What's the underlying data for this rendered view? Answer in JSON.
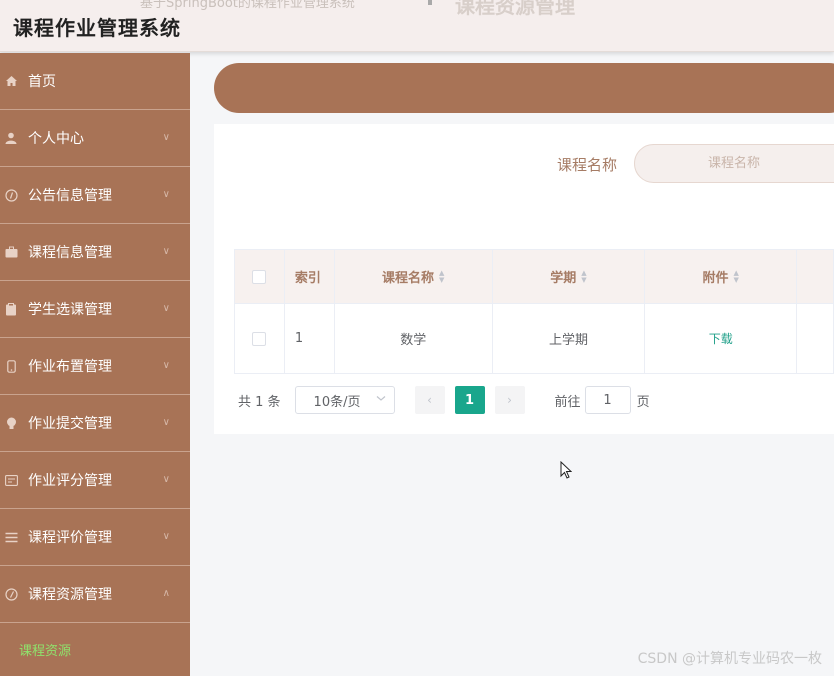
{
  "topbar": {
    "title": "课程作业管理系统",
    "ghost_left": "基于SpringBoot的课程作业管理系统",
    "ghost_right": "课程资源管理"
  },
  "sidebar": {
    "items": [
      {
        "label": "首页",
        "icon": "home-icon",
        "chevron": ""
      },
      {
        "label": "个人中心",
        "icon": "user-icon",
        "chevron": "∨"
      },
      {
        "label": "公告信息管理",
        "icon": "info-icon",
        "chevron": "∨"
      },
      {
        "label": "课程信息管理",
        "icon": "briefcase-icon",
        "chevron": "∨"
      },
      {
        "label": "学生选课管理",
        "icon": "clipboard-icon",
        "chevron": "∨"
      },
      {
        "label": "作业布置管理",
        "icon": "phone-icon",
        "chevron": "∨"
      },
      {
        "label": "作业提交管理",
        "icon": "bulb-icon",
        "chevron": "∨"
      },
      {
        "label": "作业评分管理",
        "icon": "card-icon",
        "chevron": "∨"
      },
      {
        "label": "课程评价管理",
        "icon": "list-icon",
        "chevron": "∨"
      },
      {
        "label": "课程资源管理",
        "icon": "compass-icon",
        "chevron": "∧"
      }
    ],
    "submenu_active": "课程资源"
  },
  "search": {
    "label": "课程名称",
    "placeholder": "课程名称"
  },
  "table": {
    "headers": [
      "索引",
      "课程名称",
      "学期",
      "附件"
    ],
    "sort_up": "▲",
    "sort_down": "▼",
    "rows": [
      {
        "index": "1",
        "course": "数学",
        "term": "上学期",
        "attachment": "下载"
      }
    ]
  },
  "pagination": {
    "total": "共 1 条",
    "page_size": "10条/页",
    "prev": "‹",
    "current": "1",
    "next": "›",
    "goto_label": "前往",
    "goto_value": "1",
    "page_suffix": "页"
  },
  "watermark": "CSDN @计算机专业码农一枚",
  "colors": {
    "sidebar": "#a87356",
    "accent": "#19a68c",
    "submenu_text": "#8fe36c"
  }
}
